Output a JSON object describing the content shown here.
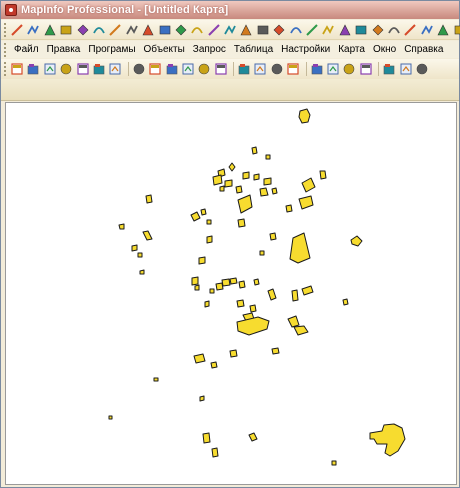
{
  "window": {
    "title": "MapInfo Professional - [Untitled Карта]"
  },
  "menu": {
    "items": [
      "Файл",
      "Правка",
      "Програмы",
      "Объекты",
      "Запрос",
      "Таблица",
      "Настройки",
      "Карта",
      "Окно",
      "Справка"
    ]
  },
  "toolbars": {
    "drawing": [
      {
        "name": "select-icon"
      },
      {
        "name": "line-icon"
      },
      {
        "name": "polyline-icon"
      },
      {
        "name": "draw-tool-icon"
      },
      {
        "name": "arc-icon"
      },
      {
        "name": "check-icon"
      },
      {
        "name": "angle-icon"
      },
      {
        "name": "area-icon"
      },
      {
        "name": "mountain-icon"
      },
      {
        "name": "measure-icon"
      },
      {
        "name": "layers-icon"
      },
      {
        "name": "diamond-icon"
      },
      {
        "name": "pencil-icon"
      },
      {
        "name": "play-icon"
      },
      {
        "name": "flag-icon"
      },
      {
        "name": "house-icon"
      },
      {
        "name": "route-icon"
      },
      {
        "name": "terrain-icon"
      },
      {
        "name": "tower-icon"
      },
      {
        "name": "building-icon"
      },
      {
        "name": "arrow-right-icon"
      },
      {
        "name": "greater-than-icon"
      },
      {
        "name": "chevron-right-icon"
      },
      {
        "name": "frame-icon"
      },
      {
        "name": "wave-icon"
      },
      {
        "name": "triangle-icon"
      },
      {
        "name": "scale-icon"
      },
      {
        "name": "signpost-icon"
      }
    ],
    "standard": [
      {
        "name": "new-icon"
      },
      {
        "name": "open-icon"
      },
      {
        "name": "open-workspace-icon"
      },
      {
        "name": "save-icon"
      },
      {
        "name": "save-copy-icon"
      },
      {
        "name": "print-preview-icon"
      },
      {
        "name": "find-icon"
      },
      {
        "name": "new-window-icon"
      },
      {
        "name": "layer-control-icon"
      },
      {
        "name": "browser-icon"
      },
      {
        "name": "map-window-icon"
      },
      {
        "name": "graph-icon"
      },
      {
        "name": "print-icon"
      },
      {
        "name": "cut-icon"
      },
      {
        "name": "copy-icon"
      },
      {
        "name": "paste-icon"
      },
      {
        "name": "undo-icon"
      },
      {
        "name": "layout-icon"
      },
      {
        "name": "legend-icon"
      },
      {
        "name": "statistics-icon"
      },
      {
        "name": "info-icon"
      },
      {
        "name": "pointer-select-icon"
      },
      {
        "name": "marquee-select-icon"
      },
      {
        "name": "radius-select-icon"
      }
    ]
  },
  "colors": {
    "feature_fill": "#f7dc2f",
    "feature_stroke": "#1a1a1a",
    "map_background": "#ffffff",
    "toolbar_background": "#f3ecd4",
    "title_text": "#ffffff"
  }
}
